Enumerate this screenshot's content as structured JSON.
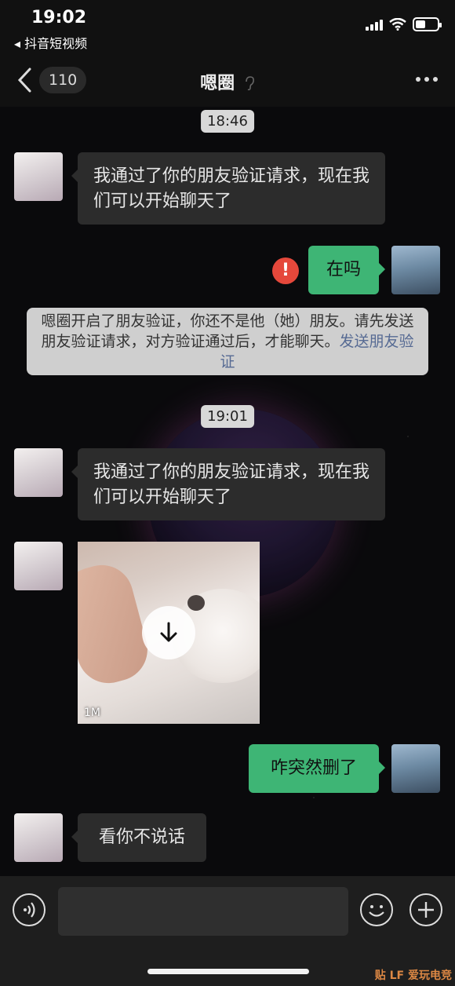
{
  "status_bar": {
    "time": "19:02",
    "back_app": "◂ 抖音短视频",
    "battery_level": 0.45
  },
  "nav": {
    "unread_count": "110",
    "title": "嗯圈"
  },
  "messages": {
    "ts1": "18:46",
    "m1": "我通过了你的朋友验证请求，现在我们可以开始聊天了",
    "m2": "在吗",
    "notice_text": "嗯圈开启了朋友验证，你还不是他（她）朋友。请先发送朋友验证请求，对方验证通过后，才能聊天。",
    "notice_link": "发送朋友验证",
    "ts2": "19:01",
    "m3": "我通过了你的朋友验证请求，现在我们可以开始聊天了",
    "image_size": "1M",
    "m4": "咋突然删了",
    "m5": "看你不说话"
  },
  "input": {
    "value": ""
  },
  "watermark": "贴 LF 爱玩电竞",
  "colors": {
    "accent_green": "#3eb575",
    "error_red": "#e5483b",
    "link_blue": "#566a93"
  },
  "icons": [
    "back-chevron-icon",
    "ear-icon",
    "more-icon",
    "error-icon",
    "download-icon",
    "voice-icon",
    "emoji-icon",
    "plus-icon"
  ]
}
